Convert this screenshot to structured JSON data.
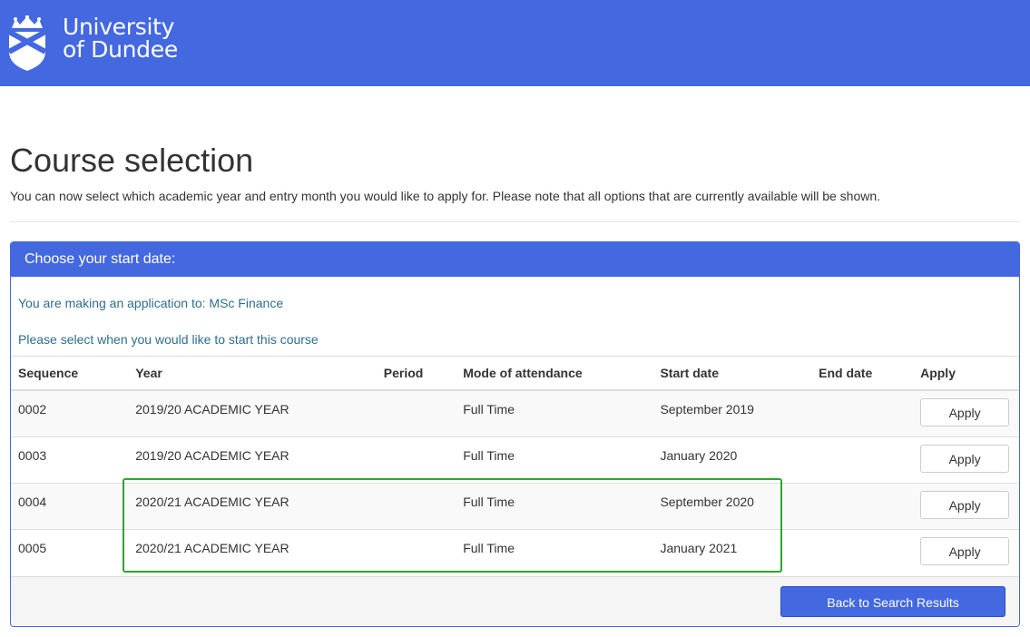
{
  "header": {
    "logo_line1": "University",
    "logo_line2": "of Dundee",
    "brand_color": "#4468e0"
  },
  "page": {
    "title": "Course selection",
    "intro": "You can now select which academic year and entry month you would like to apply for. Please note that all options that are currently available will be shown."
  },
  "panel": {
    "heading": "Choose your start date:",
    "application_line": "You are making an application to: MSc Finance",
    "select_line": "Please select when you would like to start this course"
  },
  "table": {
    "columns": {
      "sequence": "Sequence",
      "year": "Year",
      "period": "Period",
      "mode": "Mode of attendance",
      "start": "Start date",
      "end": "End date",
      "apply": "Apply"
    },
    "rows": [
      {
        "sequence": "0002",
        "year": "2019/20 ACADEMIC YEAR",
        "period": "",
        "mode": "Full Time",
        "start": "September 2019",
        "end": "",
        "apply": "Apply"
      },
      {
        "sequence": "0003",
        "year": "2019/20 ACADEMIC YEAR",
        "period": "",
        "mode": "Full Time",
        "start": "January 2020",
        "end": "",
        "apply": "Apply"
      },
      {
        "sequence": "0004",
        "year": "2020/21 ACADEMIC YEAR",
        "period": "",
        "mode": "Full Time",
        "start": "September 2020",
        "end": "",
        "apply": "Apply"
      },
      {
        "sequence": "0005",
        "year": "2020/21 ACADEMIC YEAR",
        "period": "",
        "mode": "Full Time",
        "start": "January 2021",
        "end": "",
        "apply": "Apply"
      }
    ]
  },
  "footer": {
    "back_label": "Back to Search Results"
  },
  "annotation": {
    "highlight_color": "#2fa52f"
  }
}
